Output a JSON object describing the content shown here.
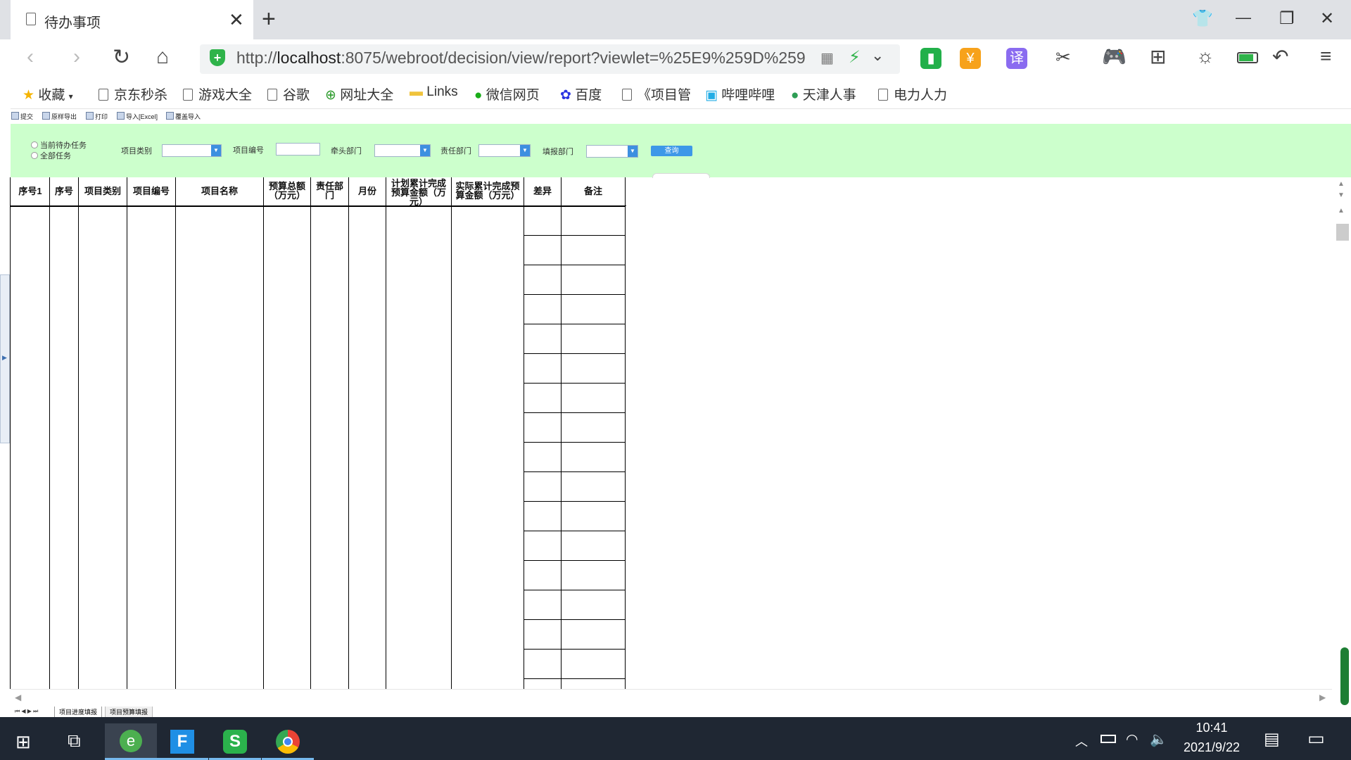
{
  "browser": {
    "tab_title": "待办事项",
    "url_prefix": "http://",
    "url_host": "localhost",
    "url_rest": ":8075/webroot/decision/view/report?viewlet=%25E9%259D%259",
    "bookmarks": [
      "收藏",
      "京东秒杀",
      "游戏大全",
      "谷歌",
      "网址大全",
      "Links",
      "微信网页",
      "百度",
      "《项目管",
      "哔哩哔哩",
      "天津人事",
      "电力人力"
    ]
  },
  "report_toolbar": {
    "items": [
      "提交",
      "原样导出",
      "打印",
      "导入[Excel]",
      "覆盖导入"
    ]
  },
  "filter": {
    "radio_current": "当前待办任务",
    "radio_all": "全部任务",
    "label_category": "项目类别",
    "label_number": "项目编号",
    "label_lead_dept": "牵头部门",
    "label_resp_dept": "责任部门",
    "label_fill_dept": "填报部门",
    "query_button": "查询"
  },
  "table": {
    "headers": [
      "序号1",
      "序号",
      "项目类别",
      "项目编号",
      "项目名称",
      "预算总额（万元）",
      "责任部门",
      "月份",
      "计划累计完成预算金额（万元）",
      "实际累计完成预算金额（万元）",
      "差异",
      "备注"
    ]
  },
  "sheets": {
    "tabs": [
      "项目进度填报",
      "项目预算填报"
    ]
  },
  "taskbar": {
    "time": "10:41",
    "date": "2021/9/22"
  },
  "colors": {
    "filter_bg": "#ccffcc",
    "accent": "#3d98e8",
    "taskbar": "#1f2733"
  }
}
